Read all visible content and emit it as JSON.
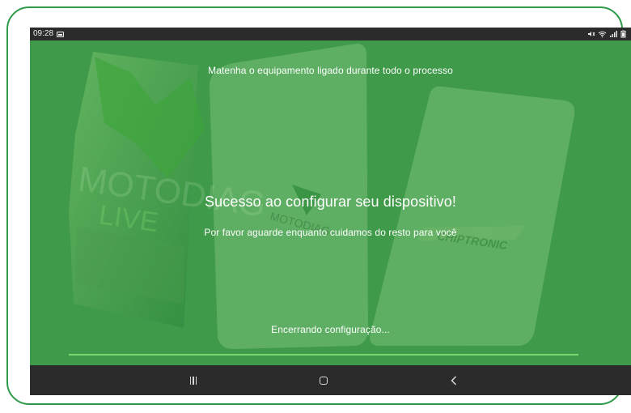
{
  "status_bar": {
    "time": "09:28",
    "icons": [
      "gallery-icon",
      "mute-icon",
      "wifi-icon",
      "signal-icon",
      "battery-icon"
    ]
  },
  "screen": {
    "top_message": "Matenha o equipamento ligado durante todo o processo",
    "success_message": "Sucesso ao configurar seu dispositivo!",
    "wait_message": "Por favor aguarde enquanto cuidamos do resto para você",
    "closing_message": "Encerrando configuração...",
    "progress_fraction": 1.0,
    "background_brand_text": {
      "main": "MOTODIAG",
      "sub": "LIVE",
      "small": "MOTODIAG",
      "chiptronic": "CHIPTRONIC"
    }
  },
  "navigation_bar": {
    "buttons": [
      "recent-apps",
      "home",
      "back"
    ]
  },
  "colors": {
    "frame_border": "#2f9a4a",
    "screen_green": "#3f9a4a",
    "status_bar": "#2b2b2b",
    "progress_fill": "#76d86f"
  }
}
